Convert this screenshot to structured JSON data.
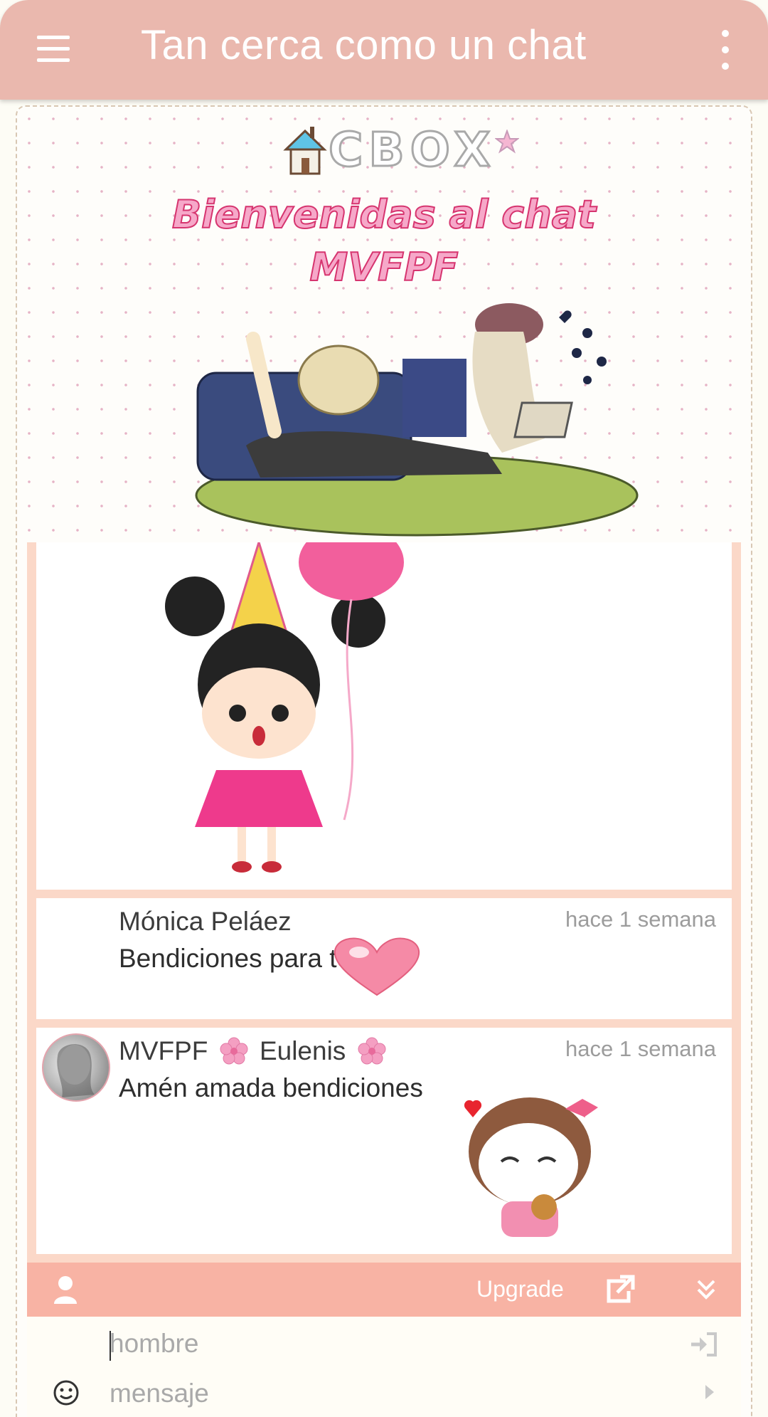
{
  "app_bar": {
    "title": "Tan cerca como un chat",
    "menu_icon": "hamburger-menu-icon",
    "more_icon": "more-vertical-icon"
  },
  "banner": {
    "logo_text": "CBOX",
    "welcome_line1": "Bienvenidas al chat",
    "welcome_line2": "MVFPF"
  },
  "messages": [
    {
      "author": "Mónica Peláez",
      "time": "hace 1 semana",
      "text": "Bendiciones para todas"
    },
    {
      "author_prefix": "MVFPF",
      "author_name": "Eulenis",
      "time": "hace 1 semana",
      "text": "Amén amada bendiciones"
    }
  ],
  "toolbar": {
    "upgrade_label": "Upgrade"
  },
  "inputs": {
    "name_placeholder": "hombre",
    "message_placeholder": "mensaje"
  },
  "colors": {
    "app_bar": "#eab8ae",
    "chat_panel": "#fbd8c8",
    "toolbar": "#f8b3a4",
    "heading_pink": "#d6356f"
  }
}
